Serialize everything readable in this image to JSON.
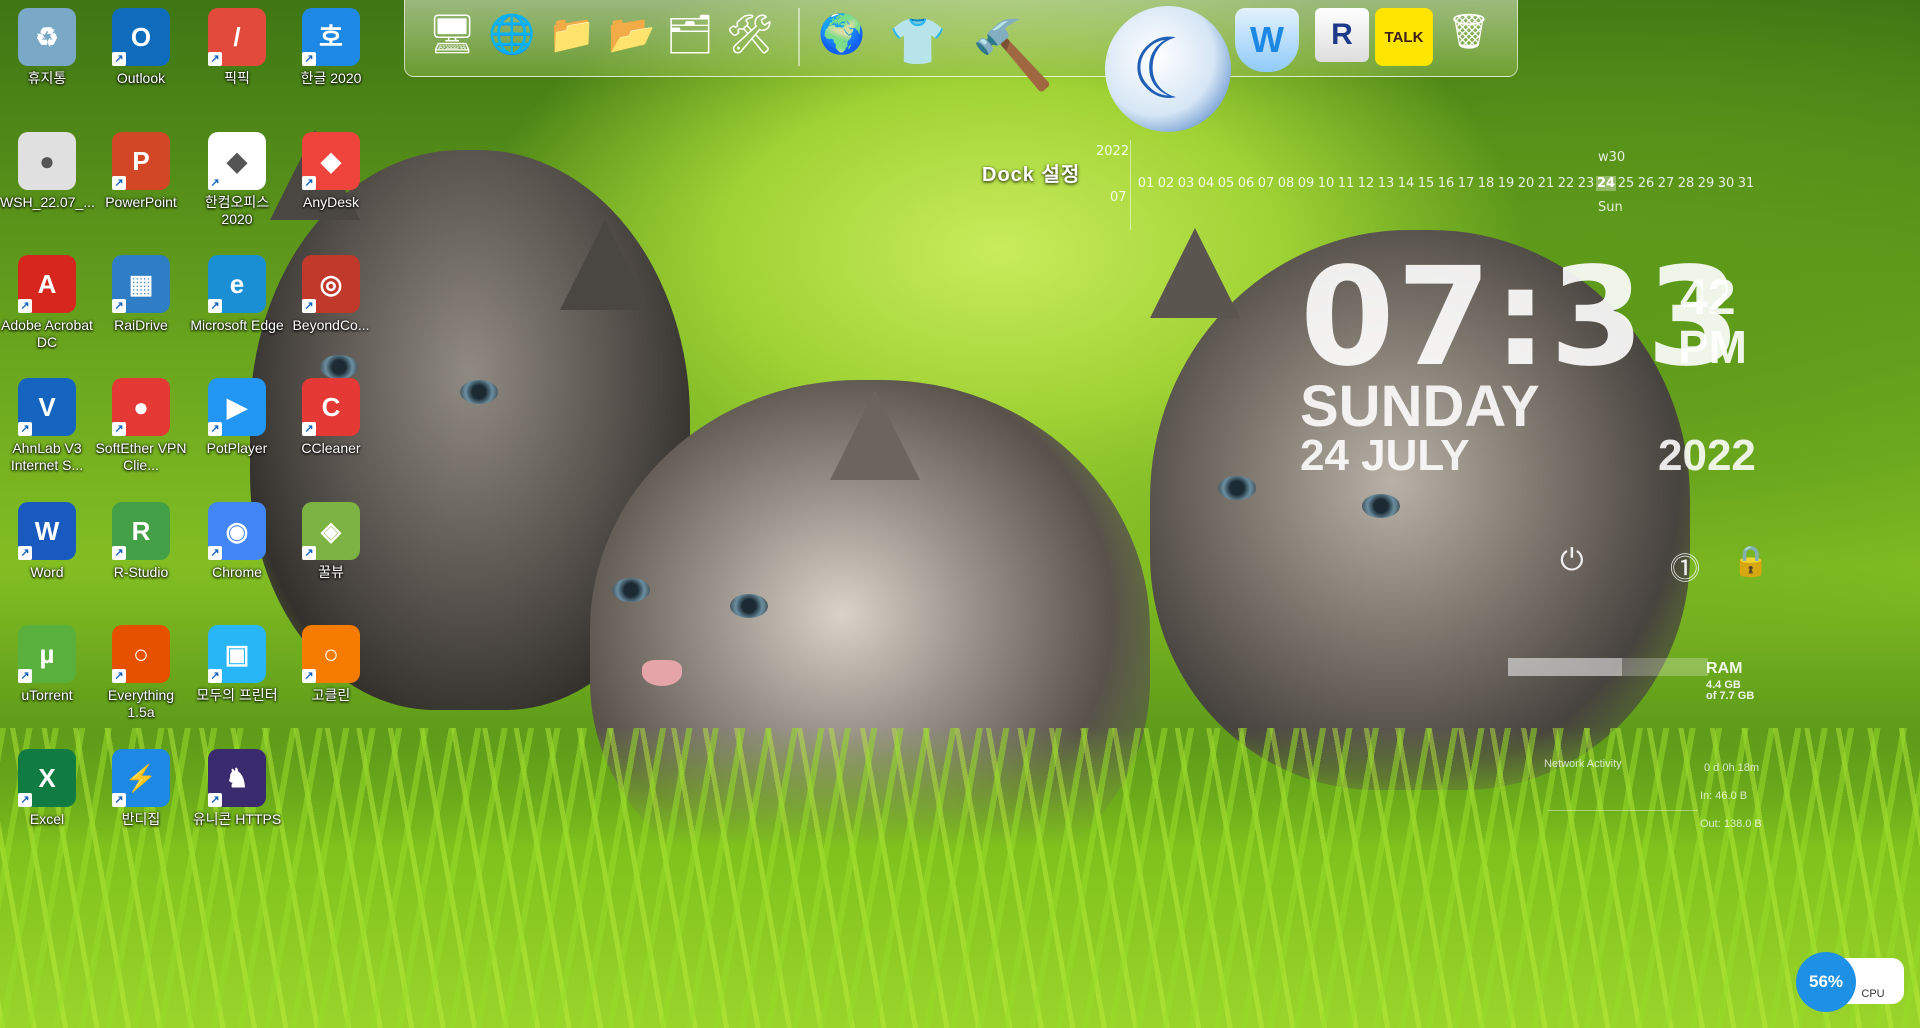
{
  "desktop_icons": [
    {
      "label": "휴지통",
      "color": "#7aa9c8",
      "glyph": "♻"
    },
    {
      "label": "Outlook",
      "color": "#0f6cbd",
      "glyph": "O"
    },
    {
      "label": "픽픽",
      "color": "#e24a3b",
      "glyph": "/"
    },
    {
      "label": "한글 2020",
      "color": "#1e88e5",
      "glyph": "호"
    },
    {
      "label": "WSH_22.07_...",
      "color": "#e0e0e0",
      "glyph": "●"
    },
    {
      "label": "PowerPoint",
      "color": "#d24726",
      "glyph": "P"
    },
    {
      "label": "한컴오피스 2020",
      "color": "#ffffff",
      "glyph": "◆"
    },
    {
      "label": "AnyDesk",
      "color": "#ef443b",
      "glyph": "◆"
    },
    {
      "label": "Adobe Acrobat DC",
      "color": "#d7261e",
      "glyph": "A"
    },
    {
      "label": "RaiDrive",
      "color": "#2f7dc4",
      "glyph": "▦"
    },
    {
      "label": "Microsoft Edge",
      "color": "#1a8fd4",
      "glyph": "e"
    },
    {
      "label": "BeyondCo...",
      "color": "#c0392b",
      "glyph": "◎"
    },
    {
      "label": "AhnLab V3 Internet S...",
      "color": "#1565c0",
      "glyph": "V"
    },
    {
      "label": "SoftEther VPN Clie...",
      "color": "#e53935",
      "glyph": "●"
    },
    {
      "label": "PotPlayer",
      "color": "#2196f3",
      "glyph": "▶"
    },
    {
      "label": "CCleaner",
      "color": "#e53935",
      "glyph": "C"
    },
    {
      "label": "Word",
      "color": "#185abd",
      "glyph": "W"
    },
    {
      "label": "R-Studio",
      "color": "#43a047",
      "glyph": "R"
    },
    {
      "label": "Chrome",
      "color": "#4285f4",
      "glyph": "◉"
    },
    {
      "label": "꿀뷰",
      "color": "#7cb342",
      "glyph": "◈"
    },
    {
      "label": "uTorrent",
      "color": "#59b03c",
      "glyph": "µ"
    },
    {
      "label": "Everything 1.5a",
      "color": "#e65100",
      "glyph": "○"
    },
    {
      "label": "모두의 프린터",
      "color": "#29b6f6",
      "glyph": "▣"
    },
    {
      "label": "고클린",
      "color": "#f57c00",
      "glyph": "○"
    },
    {
      "label": "Excel",
      "color": "#107c41",
      "glyph": "X"
    },
    {
      "label": "반디집",
      "color": "#1e88e5",
      "glyph": "⚡"
    },
    {
      "label": "유니콘 HTTPS",
      "color": "#3a2a6e",
      "glyph": "♞"
    }
  ],
  "dock": {
    "label": "Dock 설정",
    "items": [
      {
        "name": "computer-icon",
        "glyph": "🖥"
      },
      {
        "name": "network-globe-icon",
        "glyph": "🌐"
      },
      {
        "name": "folder-icon",
        "glyph": "📁"
      },
      {
        "name": "folder-green-icon",
        "glyph": "📂"
      },
      {
        "name": "drive-folder-icon",
        "glyph": "🗂"
      },
      {
        "name": "tools-icon",
        "glyph": "🛠"
      },
      {
        "name": "internet-globe-icon",
        "glyph": "🌍"
      },
      {
        "name": "tshirt-icon",
        "glyph": "👕"
      },
      {
        "name": "hammer-icon",
        "glyph": "🔨"
      },
      {
        "name": "moon-app-icon",
        "glyph": "☾"
      },
      {
        "name": "shield-w-icon",
        "glyph": "W"
      },
      {
        "name": "r-archive-icon",
        "glyph": "R"
      },
      {
        "name": "kakaotalk-icon",
        "glyph": "TALK"
      },
      {
        "name": "recycle-bin-icon",
        "glyph": "🗑"
      }
    ]
  },
  "calendar": {
    "year": "2022",
    "month": "07",
    "week": "w30",
    "today_name": "Sun",
    "days": [
      "01",
      "02",
      "03",
      "04",
      "05",
      "06",
      "07",
      "08",
      "09",
      "10",
      "11",
      "12",
      "13",
      "14",
      "15",
      "16",
      "17",
      "18",
      "19",
      "20",
      "21",
      "22",
      "23",
      "24",
      "25",
      "26",
      "27",
      "28",
      "29",
      "30",
      "31"
    ],
    "today": "24"
  },
  "clock": {
    "time": "07:33",
    "seconds": "42",
    "ampm": "PM",
    "day": "SUNDAY",
    "date": "24 JULY",
    "year": "2022"
  },
  "system": {
    "ram_label": "RAM",
    "ram_used": "4.4 GB",
    "ram_total": "of 7.7 GB",
    "ram_fraction": 0.57,
    "network_label": "Network Activity",
    "uptime": "0 d 0h 18m",
    "net_in": "In: 46.0 B",
    "net_out": "Out: 138.0 B"
  },
  "cpu": {
    "percent": "56%",
    "label": "CPU"
  }
}
